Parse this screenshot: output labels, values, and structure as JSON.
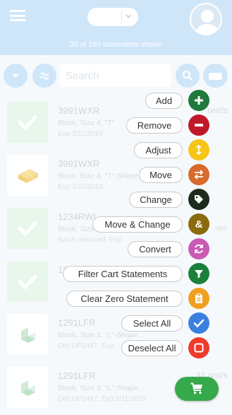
{
  "header": {
    "selected_value": "",
    "statements_shown": "30 of 250 statements shown"
  },
  "toolbar": {
    "search_placeholder": "Search"
  },
  "list": {
    "items": [
      {
        "code": "3991WXR",
        "description": "Block, Size 4, \"T\"",
        "meta": "Exp:2/11/2019",
        "qty": "unit/s",
        "subqty": "",
        "thumb": "check"
      },
      {
        "code": "3991WXR",
        "description": "Block, Size 4, \"T\"-Shape...",
        "meta": "Exp:2/11/2019",
        "qty": "",
        "subqty": "",
        "thumb": "brick"
      },
      {
        "code": "1234RWL",
        "description": "Block, Size 4, \"T\"",
        "meta": "Batch:removed, Exp:",
        "qty": "",
        "subqty": "rder",
        "thumb": "check"
      },
      {
        "code": "12",
        "description": "",
        "meta": "",
        "qty": "",
        "subqty": "",
        "thumb": "check"
      },
      {
        "code": "1291LFR",
        "description": "Block, Size 3, \"L\"-Shape...",
        "meta": "Ord:OP3497, Exp:",
        "qty": "",
        "subqty": "",
        "thumb": "block"
      },
      {
        "code": "1291LFR",
        "description": "Block, Size 3, \"L\"-Shape...",
        "meta": "Ord:OP3497, Exp:2/11/2019",
        "qty": "32 unit/s",
        "subqty": "",
        "thumb": "block"
      }
    ]
  },
  "actions": [
    {
      "label": "Add",
      "color": "#1f7a3c",
      "icon": "plus-icon"
    },
    {
      "label": "Remove",
      "color": "#c0182a",
      "icon": "minus-icon"
    },
    {
      "label": "Adjust",
      "color": "#f5c518",
      "icon": "up-down-arrow-icon"
    },
    {
      "label": "Move",
      "color": "#d86a2b",
      "icon": "swap-arrows-icon"
    },
    {
      "label": "Change",
      "color": "#1d2b1d",
      "icon": "tag-icon"
    },
    {
      "label": "Move & Change",
      "color": "#8a6a0c",
      "icon": "ampersand-icon"
    },
    {
      "label": "Convert",
      "color": "#c95bb5",
      "icon": "refresh-icon"
    },
    {
      "label": "Filter Cart Statements",
      "color": "#19803a",
      "icon": "filter-icon"
    },
    {
      "label": "Clear Zero Statement",
      "color": "#f0a020",
      "icon": "clipboard-icon"
    },
    {
      "label": "Select All",
      "color": "#3a80e0",
      "icon": "checkmark-icon"
    },
    {
      "label": "Deselect All",
      "color": "#f03a2a",
      "icon": "square-icon"
    }
  ],
  "cart": {
    "icon": "cart-icon",
    "color": "#36a94a"
  }
}
